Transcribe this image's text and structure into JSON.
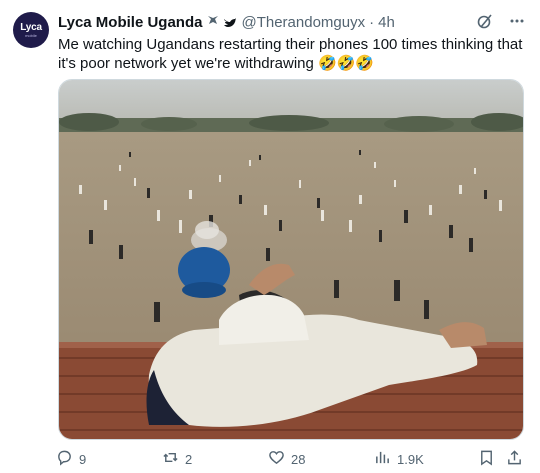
{
  "tweet": {
    "author_name": "Lyca Mobile Uganda",
    "avatar_text": "Lyca",
    "avatar_subtext": "mobile",
    "handle": "@Therandomguyx",
    "separator": "·",
    "time": "4h",
    "text": "Me watching Ugandans restarting their phones 100 times thinking that it's poor network yet we're withdrawing 🤣🤣🤣"
  },
  "actions": {
    "replies": "9",
    "retweets": "2",
    "likes": "28",
    "views": "1.9K"
  },
  "icons": [
    "verified-badge-icon",
    "bird-icon",
    "grok-icon",
    "more-icon",
    "reply-icon",
    "retweet-icon",
    "like-icon",
    "views-icon",
    "bookmark-icon",
    "share-icon"
  ]
}
